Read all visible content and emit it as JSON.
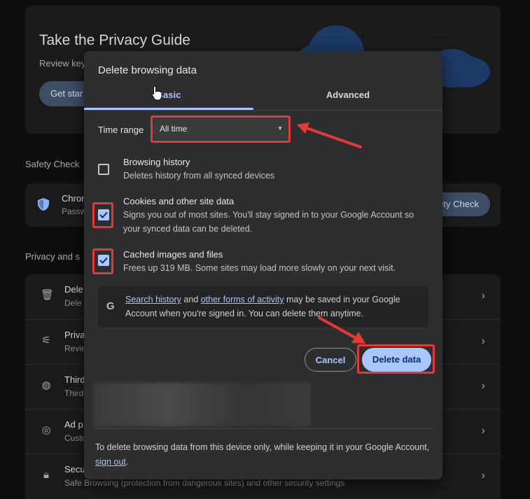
{
  "background": {
    "privacy_guide": {
      "title": "Take the Privacy Guide",
      "subtitle": "Review key",
      "button_label": "Get star"
    },
    "safety_check": {
      "section_label": "Safety Check",
      "item_title": "Chron",
      "item_sub": "Passw",
      "button_label": "ety Check"
    },
    "privacy_security": {
      "section_label": "Privacy and s",
      "rows": [
        {
          "title": "Dele",
          "sub": "Dele",
          "icon": "trash-icon"
        },
        {
          "title": "Priva",
          "sub": "Revie",
          "icon": "tune-icon"
        },
        {
          "title": "Third",
          "sub": "Third",
          "icon": "cookie-icon"
        },
        {
          "title": "Ad p",
          "sub": "Custo",
          "icon": "ad-icon"
        },
        {
          "title": "Secu",
          "sub": "Safe Browsing (protection from dangerous sites) and other security settings",
          "icon": "lock-icon"
        }
      ]
    }
  },
  "dialog": {
    "title": "Delete browsing data",
    "tabs": [
      {
        "label": "Basic",
        "selected": true
      },
      {
        "label": "Advanced",
        "selected": false
      }
    ],
    "time_range": {
      "label": "Time range",
      "value": "All time"
    },
    "options": [
      {
        "title": "Browsing history",
        "desc": "Deletes history from all synced devices",
        "checked": false
      },
      {
        "title": "Cookies and other site data",
        "desc": "Signs you out of most sites. You'll stay signed in to your Google Account so your synced data can be deleted.",
        "checked": true
      },
      {
        "title": "Cached images and files",
        "desc": "Frees up 319 MB. Some sites may load more slowly on your next visit.",
        "checked": true
      }
    ],
    "info": {
      "link1": "Search history",
      "text1": " and ",
      "link2": "other forms of activity",
      "text2": " may be saved in your Google Account when you're signed in. You can delete them anytime."
    },
    "buttons": {
      "cancel": "Cancel",
      "delete": "Delete data"
    },
    "footer": {
      "text": "To delete browsing data from this device only, while keeping it in your Google Account, ",
      "link": "sign out",
      "end": "."
    }
  },
  "colors": {
    "accent": "#a8c7fa",
    "highlight": "#e53935",
    "dialog_bg": "#2d2e30"
  }
}
